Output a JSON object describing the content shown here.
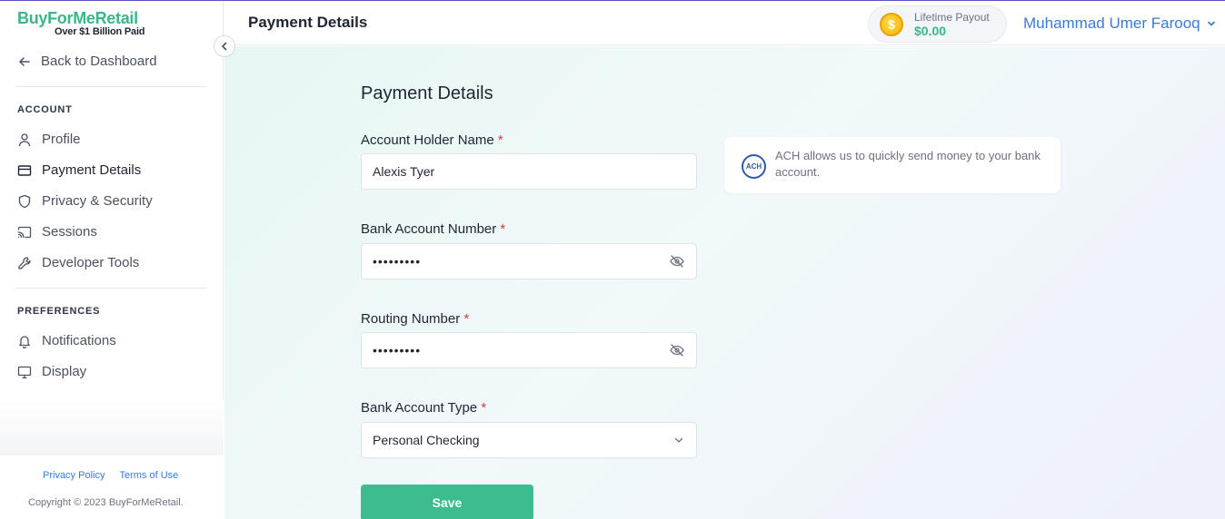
{
  "brand": {
    "name": "BuyForMeRetail",
    "tagline": "Over $1 Billion Paid"
  },
  "sidebar": {
    "back_label": "Back to Dashboard",
    "account_section": "ACCOUNT",
    "account_items": [
      {
        "label": "Profile",
        "icon": "user-icon"
      },
      {
        "label": "Payment Details",
        "icon": "card-icon"
      },
      {
        "label": "Privacy & Security",
        "icon": "shield-icon"
      },
      {
        "label": "Sessions",
        "icon": "cast-icon"
      },
      {
        "label": "Developer Tools",
        "icon": "wrench-icon"
      }
    ],
    "preferences_section": "PREFERENCES",
    "preferences_items": [
      {
        "label": "Notifications",
        "icon": "bell-icon"
      },
      {
        "label": "Display",
        "icon": "monitor-icon"
      }
    ],
    "footer": {
      "privacy_policy": "Privacy Policy",
      "terms_of_use": "Terms of Use",
      "copyright": "Copyright © 2023 BuyForMeRetail."
    }
  },
  "header": {
    "title": "Payment Details",
    "payout_label": "Lifetime Payout",
    "payout_value": "$0.00",
    "user_name": "Muhammad Umer Farooq"
  },
  "form": {
    "title": "Payment Details",
    "account_holder_label": "Account Holder Name",
    "account_holder_value": "Alexis Tyer",
    "bank_account_label": "Bank Account Number",
    "bank_account_value": "•••••••••",
    "routing_label": "Routing Number",
    "routing_value": "•••••••••",
    "account_type_label": "Bank Account Type",
    "account_type_value": "Personal Checking",
    "required_mark": "*",
    "save_label": "Save"
  },
  "info": {
    "badge": "ACH",
    "text": "ACH allows us to quickly send money to your bank account."
  },
  "colors": {
    "brand_green": "#3bb68a",
    "link_blue": "#3a7bd5",
    "save_button": "#3dbd8f",
    "required_red": "#d93b3b"
  }
}
